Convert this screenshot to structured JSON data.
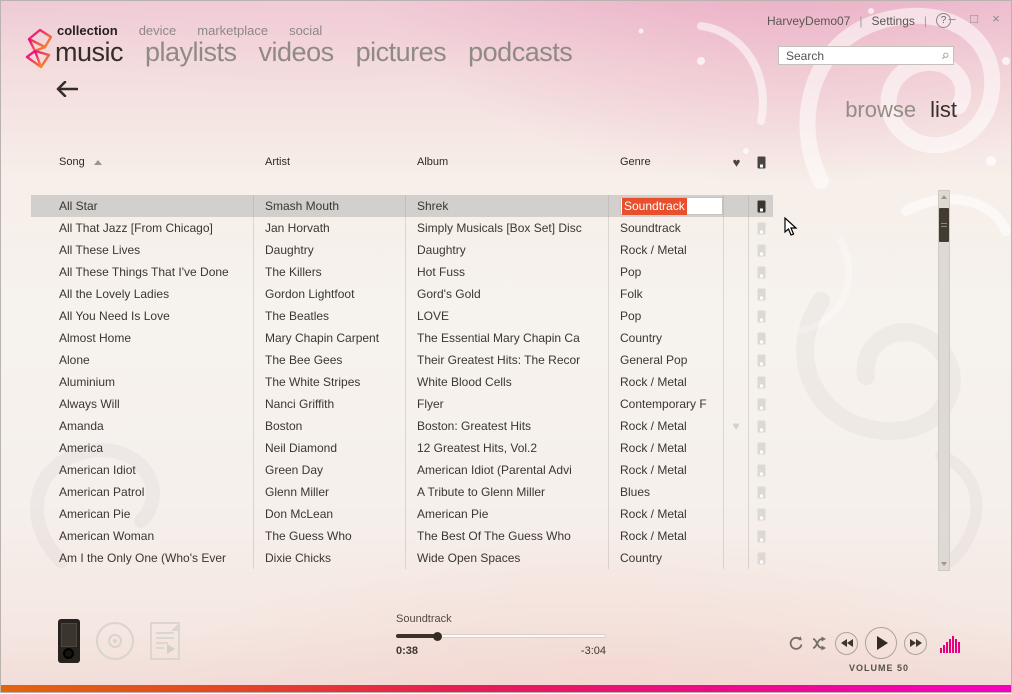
{
  "window": {
    "account_name": "HarveyDemo07",
    "settings_label": "Settings",
    "help_label": "?",
    "controls": {
      "minimize": "–",
      "maximize": "□",
      "close": "×"
    }
  },
  "nav": {
    "primary": [
      {
        "label": "collection",
        "active": true
      },
      {
        "label": "device",
        "active": false
      },
      {
        "label": "marketplace",
        "active": false
      },
      {
        "label": "social",
        "active": false
      }
    ],
    "secondary": [
      {
        "label": "music",
        "active": true
      },
      {
        "label": "playlists",
        "active": false
      },
      {
        "label": "videos",
        "active": false
      },
      {
        "label": "pictures",
        "active": false
      },
      {
        "label": "podcasts",
        "active": false
      }
    ]
  },
  "search": {
    "placeholder": "Search"
  },
  "view_toggle": {
    "browse_label": "browse",
    "list_label": "list",
    "active": "list"
  },
  "table": {
    "columns": {
      "song": "Song",
      "artist": "Artist",
      "album": "Album",
      "genre": "Genre"
    },
    "sort": {
      "column": "Song",
      "direction": "asc"
    },
    "rows": [
      {
        "song": "All Star",
        "artist": "Smash Mouth",
        "album": "Shrek",
        "genre": "Soundtrack",
        "selected": true,
        "editing_genre": true,
        "on_device": true,
        "loved": false
      },
      {
        "song": "All That Jazz [From Chicago]",
        "artist": "Jan Horvath",
        "album": "Simply Musicals [Box Set] Disc",
        "genre": "Soundtrack",
        "on_device": false,
        "loved": false
      },
      {
        "song": "All These Lives",
        "artist": "Daughtry",
        "album": "Daughtry",
        "genre": "Rock / Metal",
        "on_device": false,
        "loved": false
      },
      {
        "song": "All These Things That I've Done",
        "artist": "The Killers",
        "album": "Hot Fuss",
        "genre": "Pop",
        "on_device": false,
        "loved": false
      },
      {
        "song": "All the Lovely Ladies",
        "artist": "Gordon Lightfoot",
        "album": "Gord's Gold",
        "genre": "Folk",
        "on_device": false,
        "loved": false
      },
      {
        "song": "All You Need Is Love",
        "artist": "The Beatles",
        "album": "LOVE",
        "genre": "Pop",
        "on_device": false,
        "loved": false
      },
      {
        "song": "Almost Home",
        "artist": "Mary Chapin Carpent",
        "album": "The Essential Mary Chapin Ca",
        "genre": "Country",
        "on_device": false,
        "loved": false
      },
      {
        "song": "Alone",
        "artist": "The Bee Gees",
        "album": "Their Greatest Hits: The Recor",
        "genre": "General Pop",
        "on_device": false,
        "loved": false
      },
      {
        "song": "Aluminium",
        "artist": "The White Stripes",
        "album": "White Blood Cells",
        "genre": "Rock / Metal",
        "on_device": false,
        "loved": false
      },
      {
        "song": "Always Will",
        "artist": "Nanci Griffith",
        "album": "Flyer",
        "genre": "Contemporary F",
        "on_device": false,
        "loved": false
      },
      {
        "song": "Amanda",
        "artist": "Boston",
        "album": "Boston: Greatest Hits",
        "genre": "Rock / Metal",
        "on_device": false,
        "loved": true
      },
      {
        "song": "America",
        "artist": "Neil Diamond",
        "album": "12 Greatest Hits, Vol.2",
        "genre": "Rock / Metal",
        "on_device": false,
        "loved": false
      },
      {
        "song": "American Idiot",
        "artist": "Green Day",
        "album": "American Idiot (Parental Advi",
        "genre": "Rock / Metal",
        "on_device": false,
        "loved": false
      },
      {
        "song": "American Patrol",
        "artist": "Glenn Miller",
        "album": "A Tribute to Glenn Miller",
        "genre": "Blues",
        "on_device": false,
        "loved": false
      },
      {
        "song": "American Pie",
        "artist": "Don McLean",
        "album": "American Pie",
        "genre": "Rock / Metal",
        "on_device": false,
        "loved": false
      },
      {
        "song": "American Woman",
        "artist": "The Guess Who",
        "album": "The Best Of The Guess Who",
        "genre": "Rock / Metal",
        "on_device": false,
        "loved": false
      },
      {
        "song": "Am I the Only One (Who's Ever",
        "artist": "Dixie Chicks",
        "album": "Wide Open Spaces",
        "genre": "Country",
        "on_device": false,
        "loved": false
      }
    ]
  },
  "player": {
    "now_playing_label": "Soundtrack",
    "time_elapsed": "0:38",
    "time_remaining": "-3:04",
    "progress_percent": 20,
    "volume_label": "VOLUME 50",
    "eq_bar_heights": [
      5,
      8,
      11,
      14,
      17,
      14,
      11
    ]
  },
  "icons": {
    "back": "back-arrow-icon",
    "search": "search-icon",
    "heart_header": "heart-icon",
    "device_header": "zune-device-icon",
    "repeat": "repeat-icon",
    "shuffle": "shuffle-icon",
    "previous": "previous-icon",
    "play": "play-icon",
    "next": "next-icon",
    "equalizer": "equalizer-icon"
  },
  "colors": {
    "edit_highlight": "#e8502d",
    "eq_magenta": "#e5007d",
    "logo_pink": "#ec008c",
    "logo_orange": "#f7941d",
    "selected_row": "#d2cfcc",
    "bottom_bar_gradient": [
      "#e2650e",
      "#e51d52",
      "#f401c0"
    ]
  }
}
